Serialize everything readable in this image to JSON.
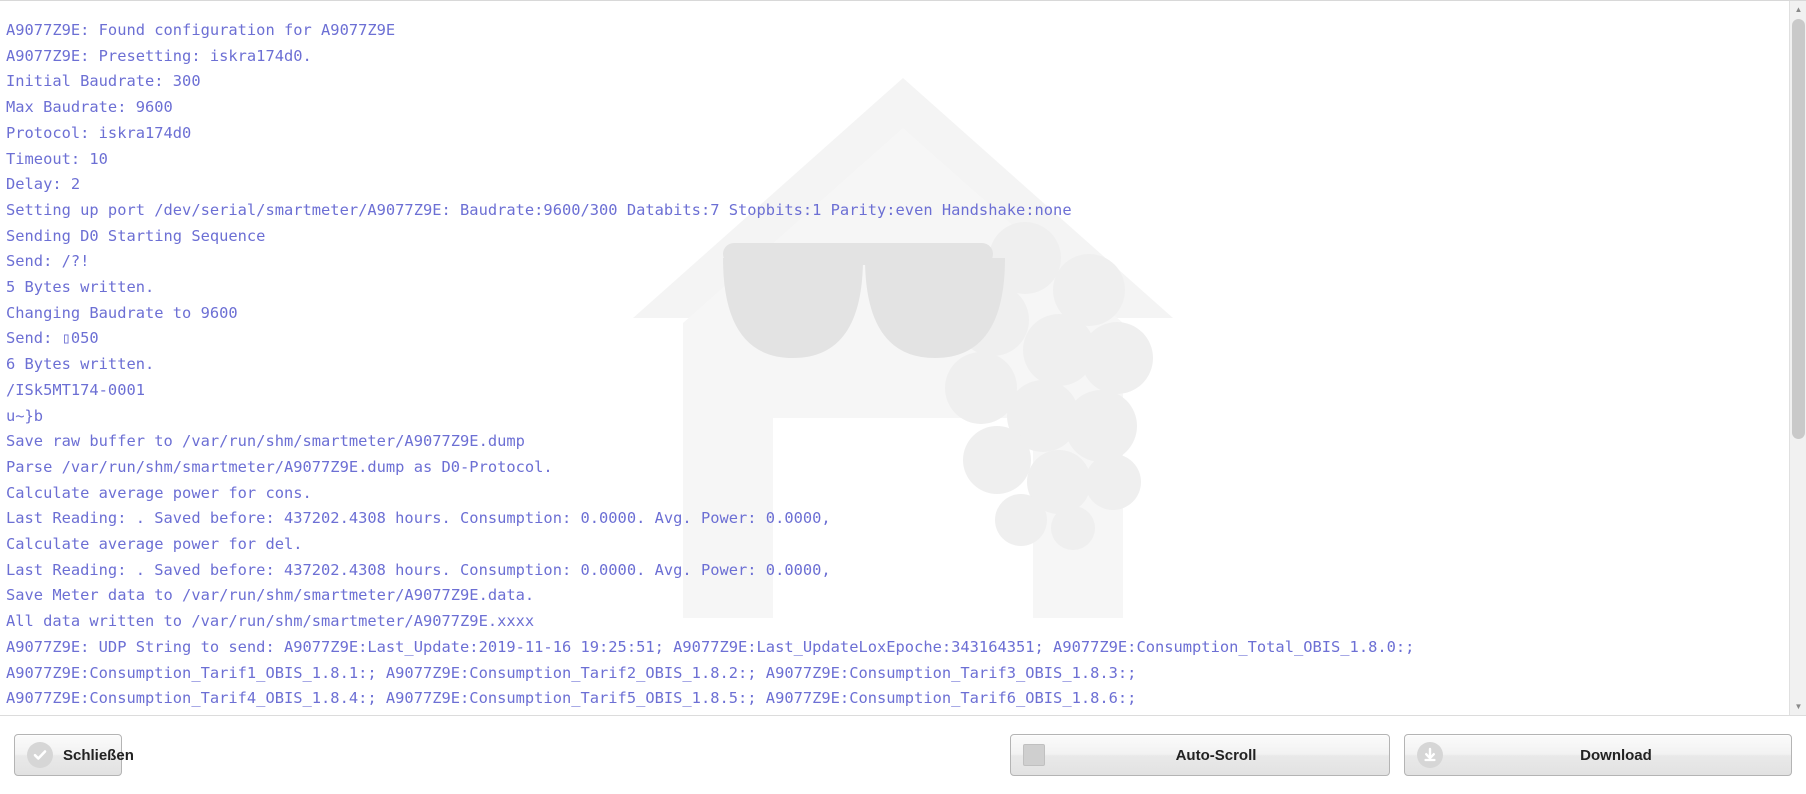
{
  "log": {
    "lines": [
      "A9077Z9E: Found configuration for A9077Z9E",
      "A9077Z9E: Presetting: iskra174d0.",
      "Initial Baudrate: 300",
      "Max Baudrate: 9600",
      "Protocol: iskra174d0",
      "Timeout: 10",
      "Delay: 2",
      "Setting up port /dev/serial/smartmeter/A9077Z9E: Baudrate:9600/300 Databits:7 Stopbits:1 Parity:even Handshake:none",
      "Sending D0 Starting Sequence",
      "Send: /?!",
      "5 Bytes written.",
      "Changing Baudrate to 9600",
      "Send: ▯050",
      "6 Bytes written.",
      "/ISk5MT174-0001",
      "u~}b",
      "Save raw buffer to /var/run/shm/smartmeter/A9077Z9E.dump",
      "Parse /var/run/shm/smartmeter/A9077Z9E.dump as D0-Protocol.",
      "Calculate average power for cons.",
      "Last Reading: . Saved before: 437202.4308 hours. Consumption: 0.0000. Avg. Power: 0.0000,",
      "Calculate average power for del.",
      "Last Reading: . Saved before: 437202.4308 hours. Consumption: 0.0000. Avg. Power: 0.0000,",
      "Save Meter data to /var/run/shm/smartmeter/A9077Z9E.data.",
      "All data written to /var/run/shm/smartmeter/A9077Z9E.xxxx",
      "A9077Z9E: UDP String to send: A9077Z9E:Last_Update:2019-11-16 19:25:51; A9077Z9E:Last_UpdateLoxEpoche:343164351; A9077Z9E:Consumption_Total_OBIS_1.8.0:;",
      "A9077Z9E:Consumption_Tarif1_OBIS_1.8.1:; A9077Z9E:Consumption_Tarif2_OBIS_1.8.2:; A9077Z9E:Consumption_Tarif3_OBIS_1.8.3:;",
      "A9077Z9E:Consumption_Tarif4_OBIS_1.8.4:; A9077Z9E:Consumption_Tarif5_OBIS_1.8.5:; A9077Z9E:Consumption_Tarif6_OBIS_1.8.6:;"
    ],
    "text_color": "#6c6fd4",
    "background_color": "#ffffff"
  },
  "scrollbar": {
    "up_arrow": "▲",
    "down_arrow": "▼"
  },
  "buttons": {
    "close": {
      "label": "Schließen",
      "icon": "check-circle-icon"
    },
    "autoscroll": {
      "label": "Auto-Scroll",
      "icon": "checkbox-unchecked-icon"
    },
    "download": {
      "label": "Download",
      "icon": "download-circle-icon"
    }
  },
  "watermark": {
    "name": "raspberry-pi-logo-watermark",
    "color": "#f0f0f0"
  }
}
